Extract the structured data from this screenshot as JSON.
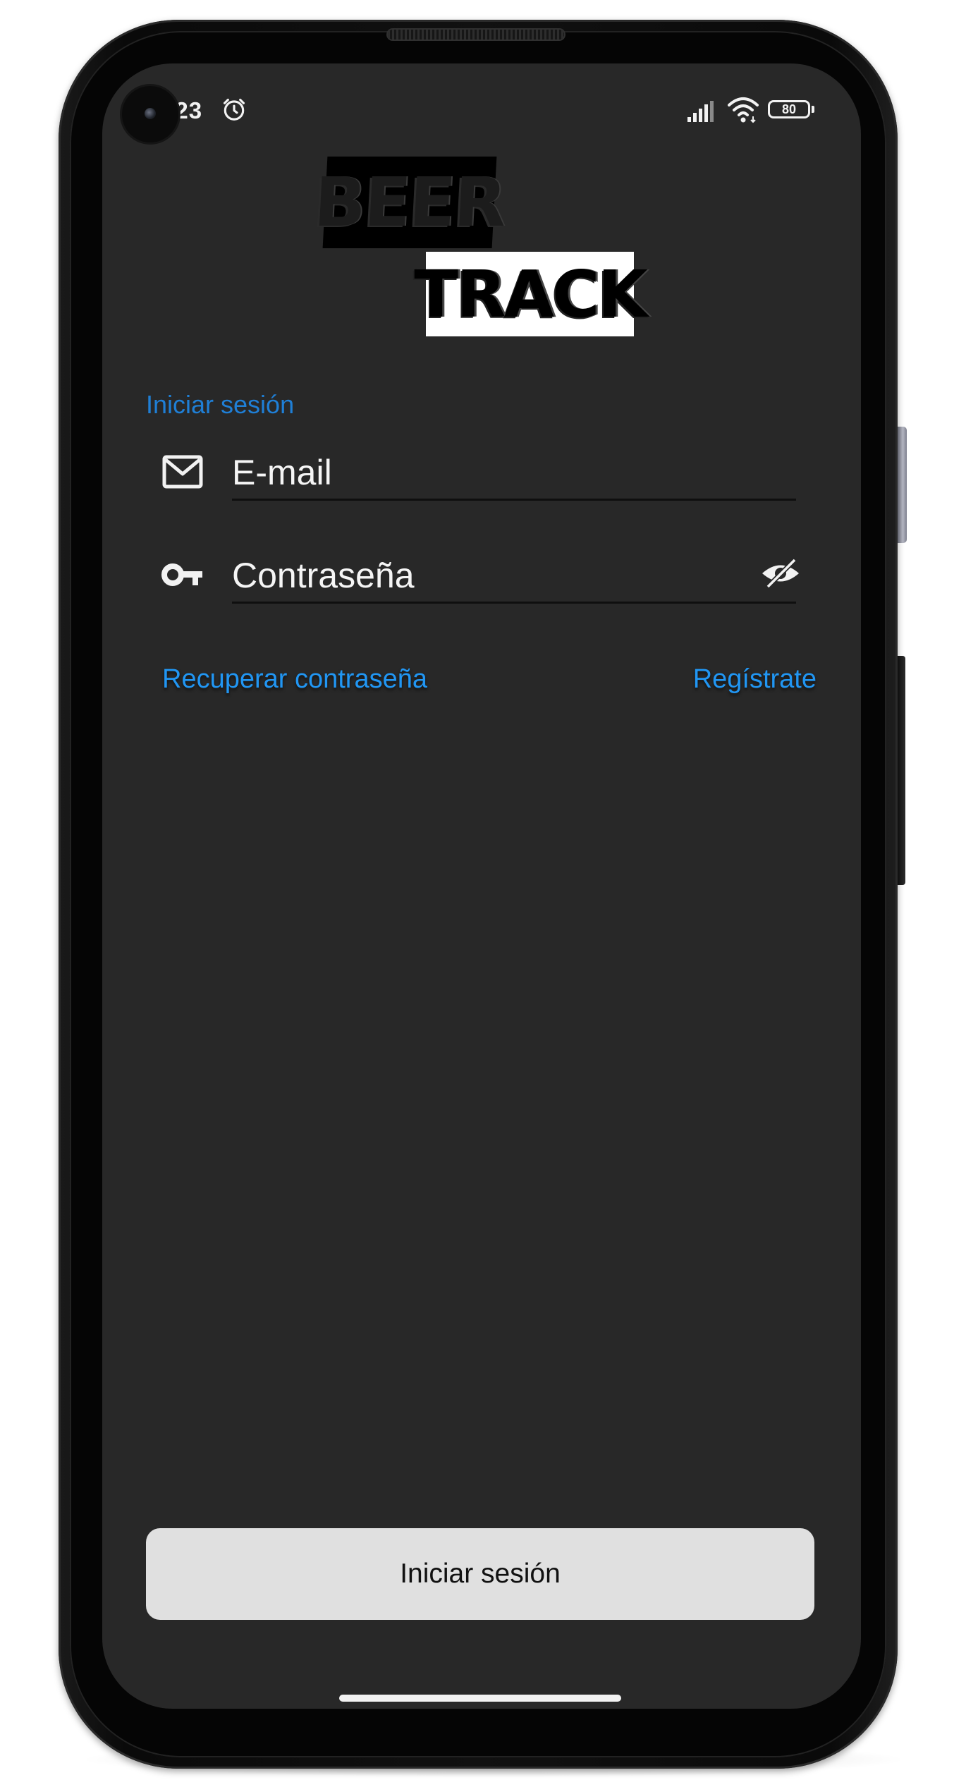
{
  "status_bar": {
    "time": "0:23",
    "battery_level": "80",
    "alarm_icon": "alarm-clock-icon",
    "signal_icon": "cellular-signal-icon",
    "wifi_icon": "wifi-icon"
  },
  "logo": {
    "line1": "BEER",
    "line2": "TRACK"
  },
  "form": {
    "title": "Iniciar sesión",
    "email": {
      "icon": "mail-icon",
      "placeholder": "E-mail",
      "value": ""
    },
    "password": {
      "icon": "key-icon",
      "placeholder": "Contraseña",
      "value": "",
      "toggle_icon": "eye-off-icon"
    },
    "recover_link": "Recuperar contraseña",
    "register_link": "Regístrate",
    "submit_label": "Iniciar sesión"
  },
  "colors": {
    "screen_background": "#282828",
    "accent": "#2196f3",
    "title_accent": "#1f7fd6",
    "button_background": "#e0e0e0"
  }
}
